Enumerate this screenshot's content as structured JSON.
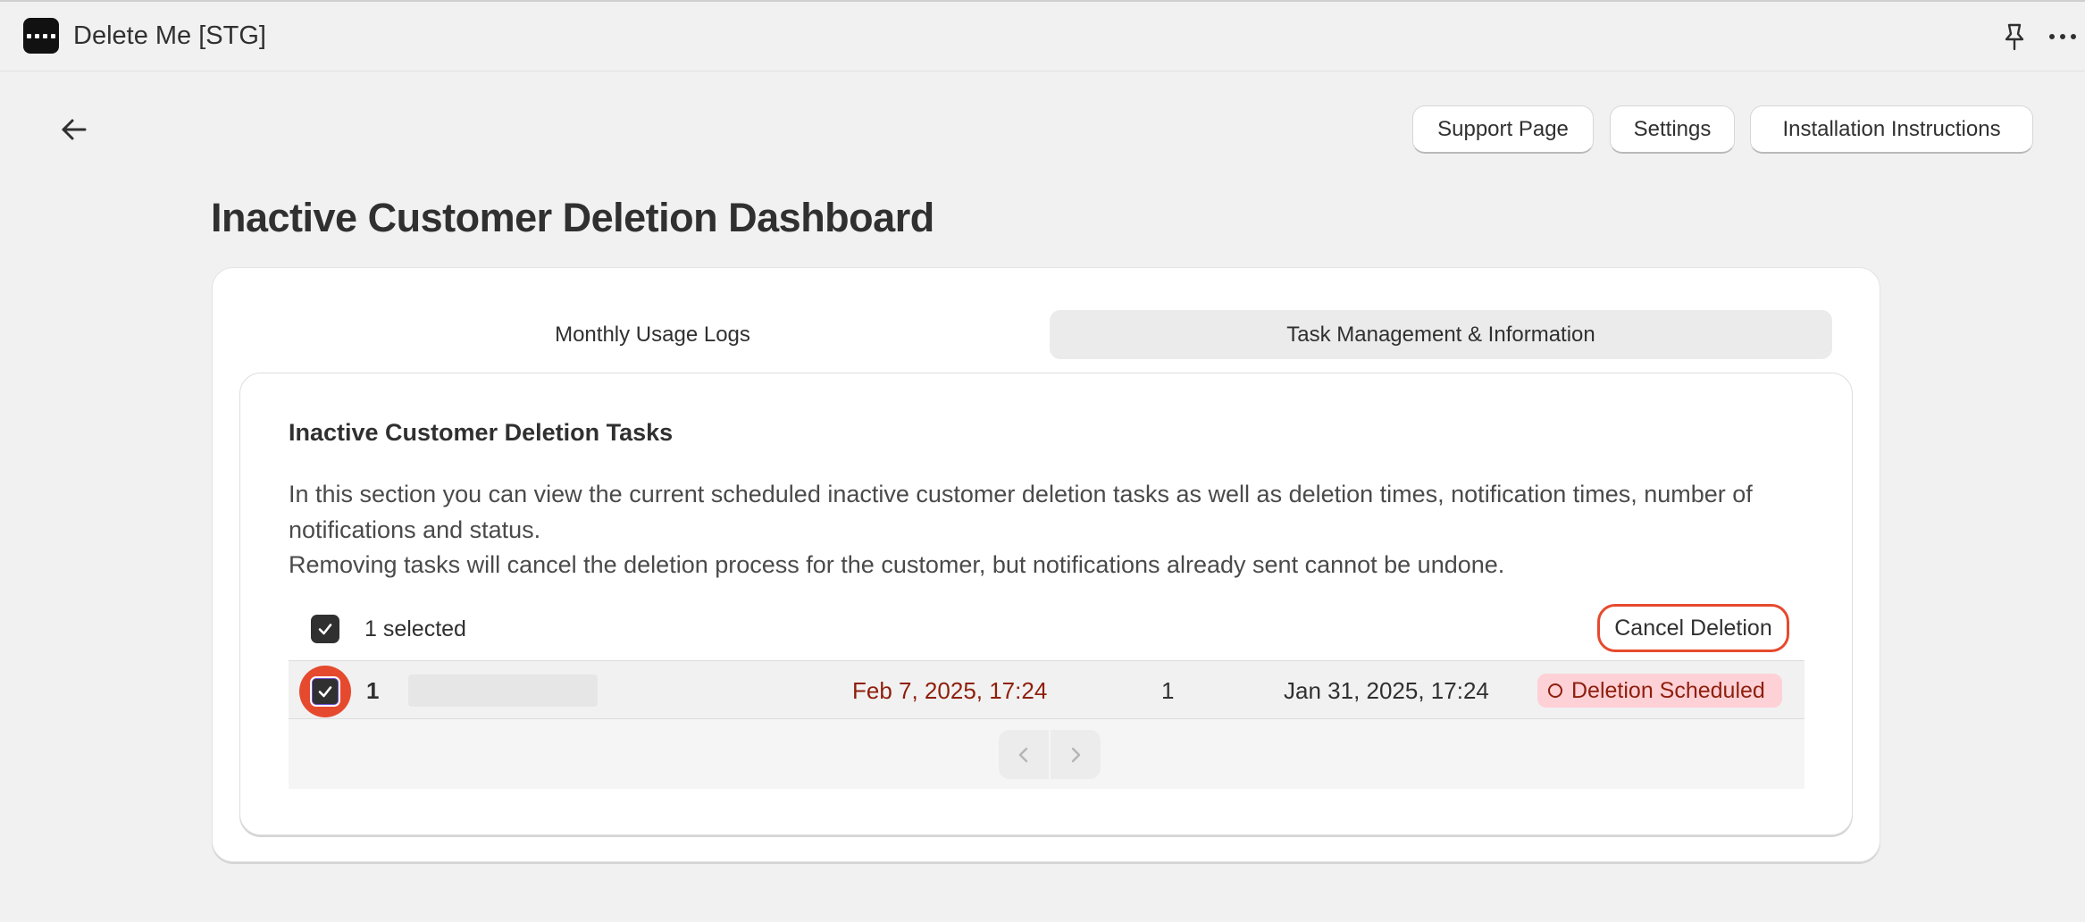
{
  "app": {
    "title": "Delete Me [STG]",
    "logo_icon": "app-logo-icon"
  },
  "header": {
    "buttons": {
      "support": "Support Page",
      "settings": "Settings",
      "install": "Installation Instructions"
    }
  },
  "page": {
    "title": "Inactive Customer Deletion Dashboard"
  },
  "tabs": [
    {
      "label": "Monthly Usage Logs",
      "selected": false
    },
    {
      "label": "Task Management & Information",
      "selected": true
    }
  ],
  "section": {
    "title": "Inactive Customer Deletion Tasks",
    "description_line1": "In this section you can view the current scheduled inactive customer deletion tasks as well as deletion times, notification times, number of notifications and status.",
    "description_line2": "Removing tasks will cancel the deletion process for the customer, but notifications already sent cannot be undone."
  },
  "bulk": {
    "selected_label": "1 selected",
    "cancel_label": "Cancel Deletion"
  },
  "rows": [
    {
      "index": "1",
      "deletion_time": "Feb 7, 2025, 17:24",
      "notification_count": "1",
      "notification_time": "Jan 31, 2025, 17:24",
      "status": "Deletion Scheduled",
      "selected": true
    }
  ],
  "colors": {
    "accent_highlight": "#e64a2e",
    "critical_text": "#8e1f0b",
    "critical_badge_bg": "#fed1d7"
  }
}
